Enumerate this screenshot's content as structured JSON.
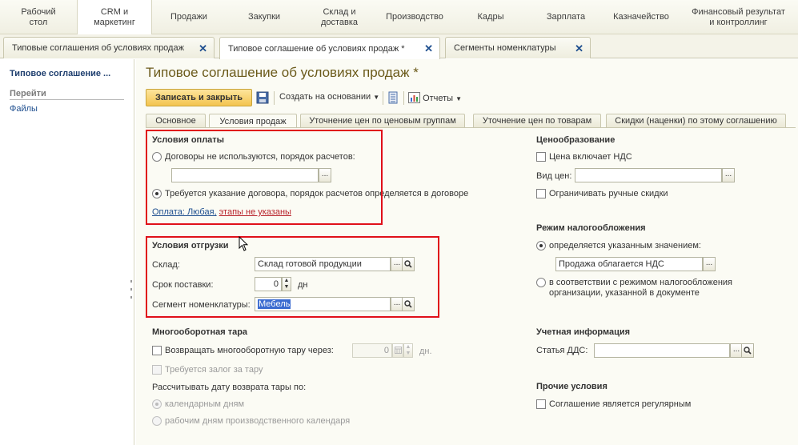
{
  "topmenu": [
    "Рабочий\nстол",
    "CRM и\nмаркетинг",
    "Продажи",
    "Закупки",
    "Склад и\nдоставка",
    "Производство",
    "Кадры",
    "Зарплата",
    "Казначейство",
    "Финансовый результат\nи контроллинг"
  ],
  "window_tabs": [
    "Типовые соглашения об условиях продаж",
    "Типовое соглашение об условиях продаж *",
    "Сегменты номенклатуры"
  ],
  "close_glyph": "✕",
  "leftnav": {
    "title": "Типовое соглашение ...",
    "group": "Перейти",
    "link": "Файлы"
  },
  "page_title": "Типовое соглашение об условиях продаж *",
  "toolbar": {
    "save_close": "Записать и закрыть",
    "create_based": "Создать на основании",
    "reports": "Отчеты"
  },
  "form_tabs": [
    "Основное",
    "Условия продаж",
    "Уточнение цен по ценовым группам",
    "Уточнение цен по товарам",
    "Скидки (наценки) по этому соглашению"
  ],
  "payment": {
    "title": "Условия оплаты",
    "opt1": "Договоры не используются, порядок расчетов:",
    "opt2": "Требуется указание договора, порядок расчетов определяется в договоре",
    "link_blue": "Оплата: Любая",
    "link_sep": ",",
    "link_red": "этапы не указаны"
  },
  "shipping": {
    "title": "Условия отгрузки",
    "warehouse_label": "Склад:",
    "warehouse_value": "Склад готовой продукции",
    "term_label": "Срок поставки:",
    "term_value": "0",
    "term_unit": "дн",
    "segment_label": "Сегмент номенклатуры:",
    "segment_value": "Мебель"
  },
  "tare": {
    "title": "Многооборотная тара",
    "return_label": "Возвращать многооборотную тару через:",
    "return_value": "0",
    "return_unit": "дн.",
    "deposit": "Требуется залог за тару",
    "calc_label": "Рассчитывать дату возврата тары по:",
    "opt_calendar": "календарным дням",
    "opt_work": "рабочим дням производственного календаря"
  },
  "pricing": {
    "title": "Ценообразование",
    "vat_incl": "Цена включает НДС",
    "price_type_label": "Вид цен:",
    "limit_discounts": "Ограничивать ручные скидки"
  },
  "tax": {
    "title": "Режим налогообложения",
    "opt1": "определяется указанным значением:",
    "value": "Продажа облагается НДС",
    "opt2_line1": "в соответствии с режимом налогообложения",
    "opt2_line2": "организации, указанной в документе"
  },
  "accounting": {
    "title": "Учетная информация",
    "dds_label": "Статья ДДС:"
  },
  "other": {
    "title": "Прочие условия",
    "regular": "Соглашение является регулярным"
  }
}
